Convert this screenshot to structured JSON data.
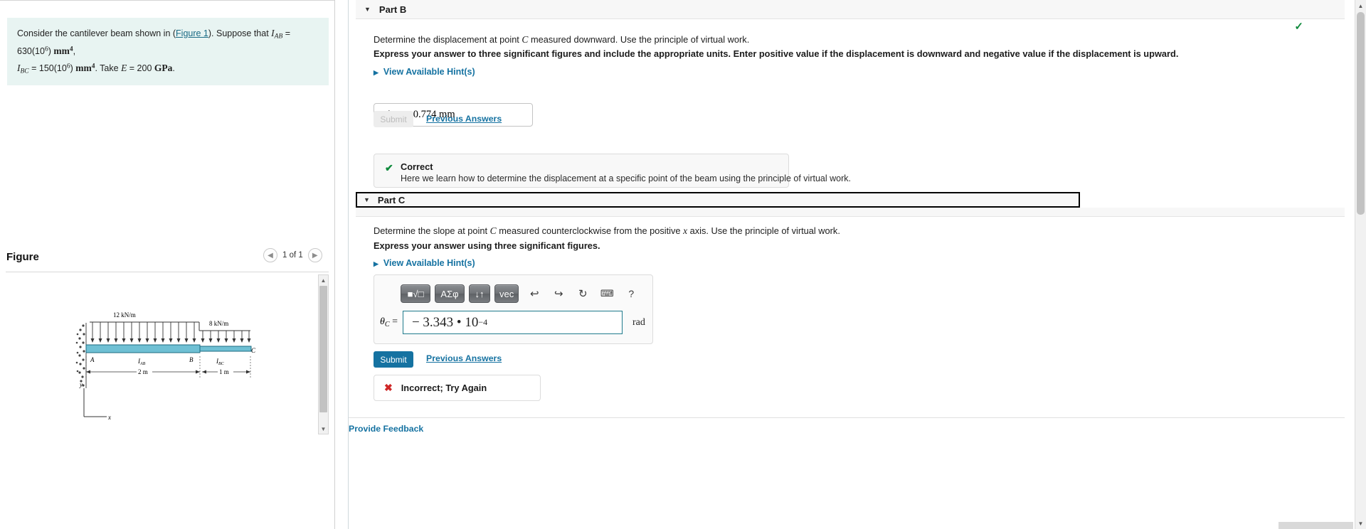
{
  "problem": {
    "text_prefix": "Consider the cantilever beam shown in (",
    "figure_link": "Figure 1",
    "text_mid": "). Suppose that ",
    "i_ab_symbol": "I",
    "i_ab_sub": "AB",
    "i_ab_value": " = 630(10",
    "i_ab_exp": "6",
    "i_ab_unit_close": ") ",
    "i_ab_unit": "mm",
    "i_ab_unit_exp": "4",
    "comma": ",",
    "i_bc_symbol": "I",
    "i_bc_sub": "BC",
    "i_bc_value": " = 150(10",
    "i_bc_exp": "6",
    "i_bc_unit_close": ") ",
    "i_bc_unit": "mm",
    "i_bc_unit_exp": "4",
    "take_text": ". Take ",
    "e_symbol": "E",
    "e_value": " = 200 ",
    "e_unit": "GPa",
    "period": "."
  },
  "figure": {
    "title": "Figure",
    "counter": "1 of 1",
    "prev_icon": "chevron-left-icon",
    "next_icon": "chevron-right-icon",
    "diagram": {
      "load_left": "12 kN/m",
      "load_right": "8 kN/m",
      "point_a": "A",
      "point_b": "B",
      "point_c": "C",
      "span_ab_label": "I",
      "span_ab_sub": "AB",
      "span_bc_label": "I",
      "span_bc_sub": "BC",
      "dim_ab": "2 m",
      "dim_bc": "1 m",
      "axis_y": "y",
      "axis_x": "x"
    }
  },
  "partB": {
    "label": "Part B",
    "caret_icon": "caret-down-icon",
    "status_icon": "check-icon",
    "prompt1": "Determine the displacement at point C measured downward. Use the principle of virtual work.",
    "prompt1_pre": "Determine the displacement at point ",
    "prompt1_var": "C",
    "prompt1_post": " measured downward. Use the principle of virtual work.",
    "prompt2": "Express your answer to three significant figures and include the appropriate units. Enter positive value if the displacement is downward and negative value if the displacement is upward.",
    "hints_label": "View Available Hint(s)",
    "answer_symbol": "Δ",
    "answer_sub": "C",
    "answer_eq": "=",
    "answer_value": "0.774 mm",
    "submit_label": "Submit",
    "previous_answers_label": "Previous Answers",
    "feedback_title": "Correct",
    "feedback_desc": "Here we learn how to determine the displacement at a specific point of the beam using the principle of virtual work."
  },
  "partC": {
    "label": "Part C",
    "caret_icon": "caret-down-icon",
    "prompt1_pre": "Determine the slope at point ",
    "prompt1_var": "C",
    "prompt1_mid": " measured counterclockwise from the positive ",
    "prompt1_var2": "x",
    "prompt1_post": " axis. Use the principle of virtual work.",
    "prompt2": "Express your answer using three significant figures.",
    "hints_label": "View Available Hint(s)",
    "toolbar": {
      "template_button": "■√□",
      "template_icon": "math-template-icon",
      "greek_button": "ΑΣφ",
      "greek_icon": "greek-letters-icon",
      "arrows_button": "↓↑",
      "arrows_icon": "updown-arrows-icon",
      "vec_button": "vec",
      "vec_icon": "vector-icon",
      "undo_icon": "undo-icon",
      "redo_icon": "redo-icon",
      "reset_icon": "reset-icon",
      "keyboard_icon": "keyboard-icon",
      "help_icon": "help-icon",
      "undo_glyph": "↩",
      "redo_glyph": "↪",
      "reset_glyph": "↻",
      "keyboard_glyph": "⌨",
      "help_glyph": "?"
    },
    "answer_symbol": "θ",
    "answer_sub": "C",
    "answer_eq": "=",
    "answer_value": "− 3.343 • 10",
    "answer_exponent": "−4",
    "answer_unit": "rad",
    "submit_label": "Submit",
    "previous_answers_label": "Previous Answers",
    "feedback_icon": "x-icon",
    "feedback_title": "Incorrect; Try Again"
  },
  "footer": {
    "provide_feedback": "Provide Feedback"
  },
  "scrollbars": {
    "up_glyph": "▲",
    "down_glyph": "▼"
  },
  "colors": {
    "link": "#1572a1",
    "correct": "#0f8a3c",
    "incorrect": "#cf2626",
    "problem_bg": "#e8f4f2",
    "submit_active": "#1572a1",
    "input_focus_border": "#1f7a8c"
  }
}
